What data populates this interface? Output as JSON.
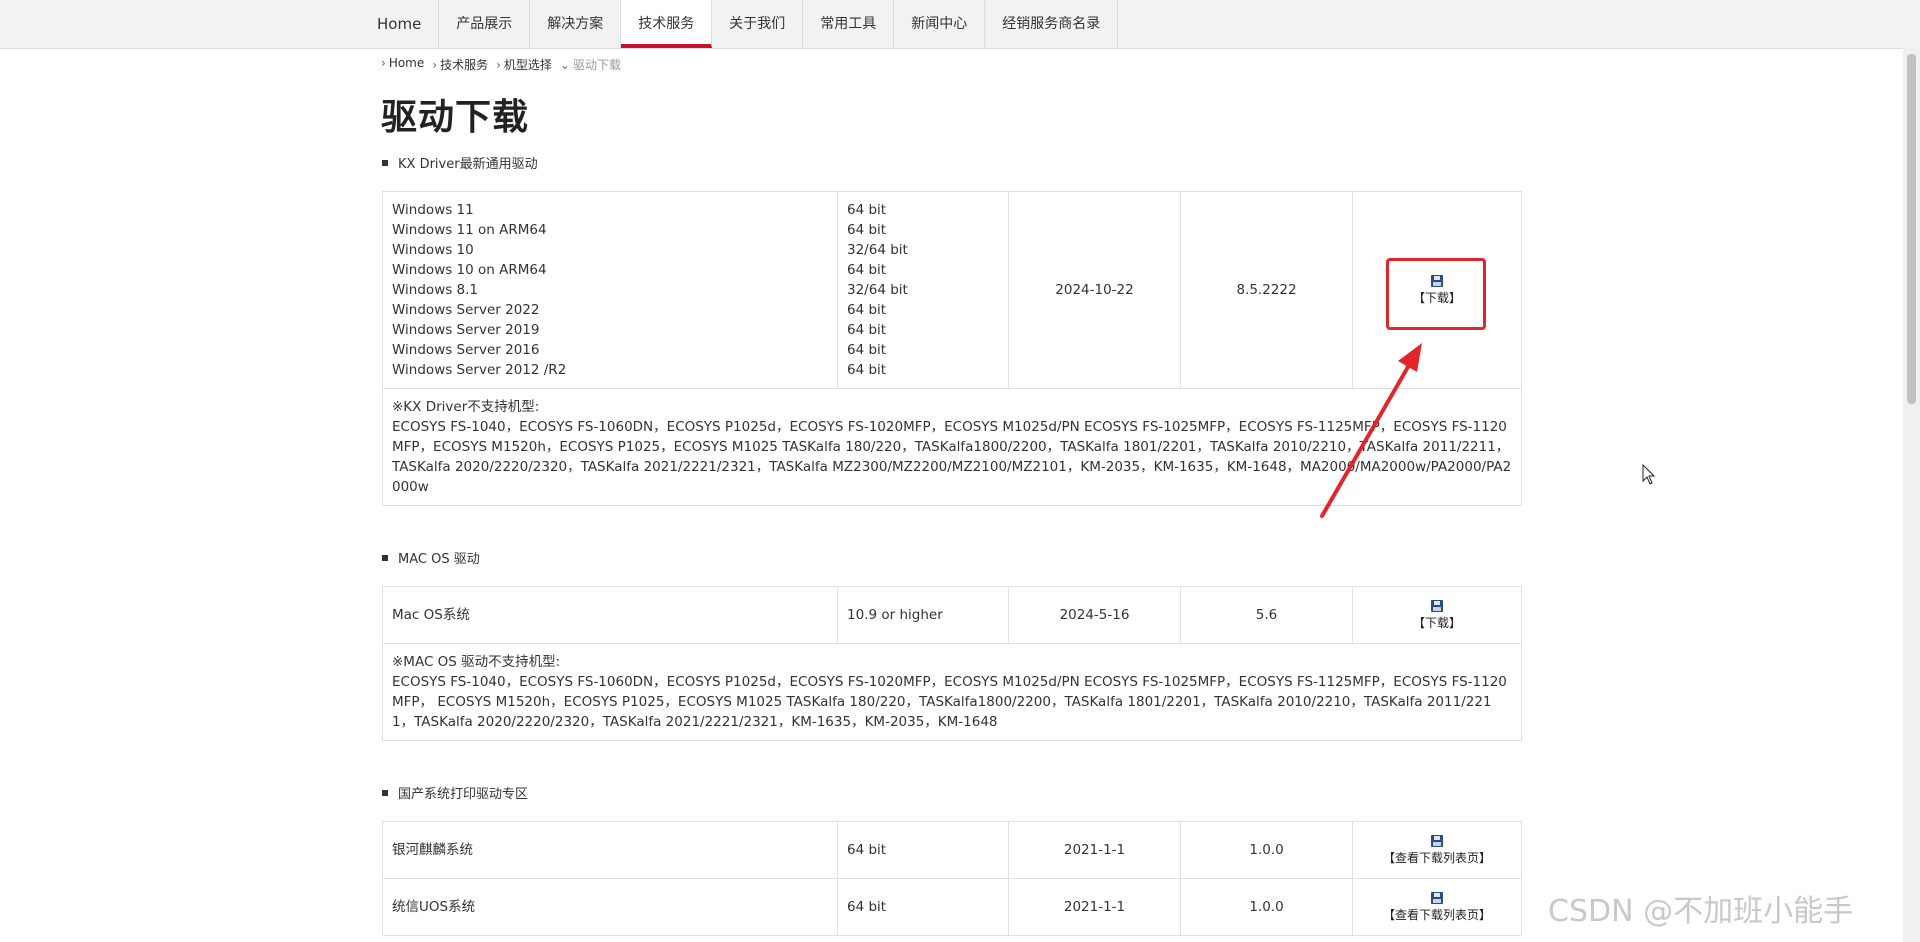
{
  "nav": {
    "items": [
      "Home",
      "产品展示",
      "解决方案",
      "技术服务",
      "关于我们",
      "常用工具",
      "新闻中心",
      "经销服务商名录"
    ],
    "active_index": 3,
    "active_color": "#c8102e"
  },
  "breadcrumb": [
    "Home",
    "技术服务",
    "机型选择",
    "驱动下载"
  ],
  "page_title": "驱动下载",
  "sections": {
    "kx": {
      "heading": "KX Driver最新通用驱动",
      "os": [
        "Windows 11",
        "Windows 11 on ARM64",
        "Windows 10",
        "Windows 10 on ARM64",
        "Windows 8.1",
        "Windows Server 2022",
        "Windows Server 2019",
        "Windows Server 2016",
        "Windows Server 2012 /R2"
      ],
      "bits": [
        "64 bit",
        "64 bit",
        "32/64 bit",
        "64 bit",
        "32/64 bit",
        "64 bit",
        "64 bit",
        "64 bit",
        "64 bit"
      ],
      "date": "2024-10-22",
      "version": "8.5.2222",
      "download_label": "【下载】",
      "note_title": "※KX Driver不支持机型:",
      "note_body": "ECOSYS FS-1040，ECOSYS FS-1060DN，ECOSYS P1025d，ECOSYS FS-1020MFP，ECOSYS M1025d/PN ECOSYS FS-1025MFP，ECOSYS FS-1125MFP，ECOSYS FS-1120MFP，ECOSYS M1520h，ECOSYS P1025，ECOSYS M1025 TASKalfa 180/220，TASKalfa1800/2200，TASKalfa 1801/2201，TASKalfa 2010/2210，TASKalfa 2011/2211，TASKalfa 2020/2220/2320，TASKalfa 2021/2221/2321，TASKalfa MZ2300/MZ2200/MZ2100/MZ2101，KM-2035，KM-1635，KM-1648，MA2000/MA2000w/PA2000/PA2000w"
    },
    "mac": {
      "heading": "MAC OS 驱动",
      "os": "Mac OS系统",
      "bit": "10.9 or higher",
      "date": "2024-5-16",
      "version": "5.6",
      "download_label": "【下载】",
      "note_title": "※MAC OS 驱动不支持机型:",
      "note_body": "ECOSYS FS-1040，ECOSYS FS-1060DN，ECOSYS P1025d，ECOSYS FS-1020MFP，ECOSYS M1025d/PN ECOSYS FS-1025MFP，ECOSYS FS-1125MFP，ECOSYS FS-1120MFP， ECOSYS M1520h，ECOSYS P1025，ECOSYS M1025 TASKalfa 180/220，TASKalfa1800/2200，TASKalfa 1801/2201，TASKalfa 2010/2210，TASKalfa 2011/2211，TASKalfa 2020/2220/2320，TASKalfa 2021/2221/2321，KM-1635，KM-2035，KM-1648"
    },
    "domestic": {
      "heading": "国产系统打印驱动专区",
      "rows": [
        {
          "os": "银河麒麟系统",
          "bit": "64 bit",
          "date": "2021-1-1",
          "version": "1.0.0",
          "link": "【查看下载列表页】"
        },
        {
          "os": "统信UOS系统",
          "bit": "64 bit",
          "date": "2021-1-1",
          "version": "1.0.0",
          "link": "【查看下载列表页】"
        }
      ]
    }
  },
  "annotation": {
    "color": "#e3242b"
  },
  "watermark": "CSDN @不加班小能手"
}
